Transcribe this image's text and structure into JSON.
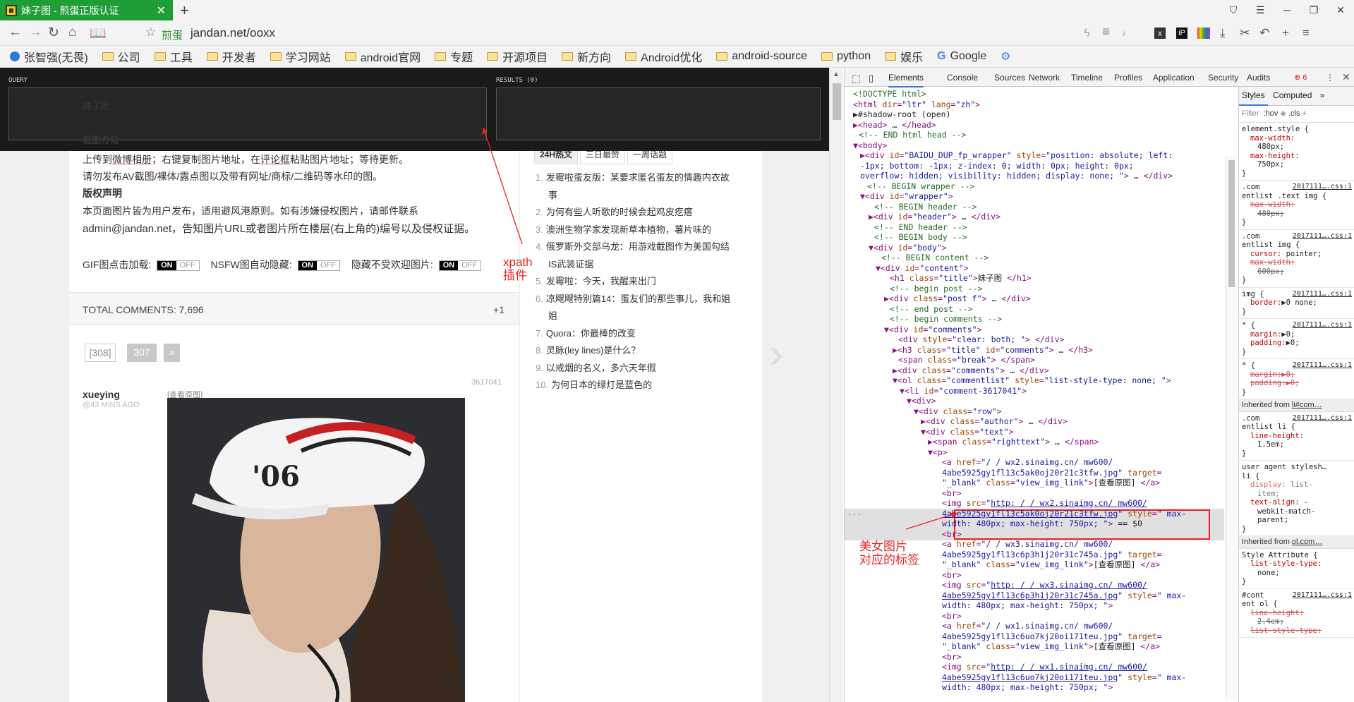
{
  "tab": {
    "title": "妹子图 - 煎蛋正版认证"
  },
  "window": {
    "new_tab": "+"
  },
  "address": {
    "label": "煎蛋",
    "url": "jandan.net/ooxx"
  },
  "bookmarks": [
    {
      "label": "张智强(无畏)",
      "type": "user"
    },
    {
      "label": "公司",
      "type": "folder"
    },
    {
      "label": "工具",
      "type": "folder"
    },
    {
      "label": "开发者",
      "type": "folder"
    },
    {
      "label": "学习网站",
      "type": "folder"
    },
    {
      "label": "android官网",
      "type": "folder"
    },
    {
      "label": "专题",
      "type": "folder"
    },
    {
      "label": "开源项目",
      "type": "folder"
    },
    {
      "label": "新方向",
      "type": "folder"
    },
    {
      "label": "Android优化",
      "type": "folder"
    },
    {
      "label": "android-source",
      "type": "folder"
    },
    {
      "label": "python",
      "type": "folder"
    },
    {
      "label": "娱乐",
      "type": "folder"
    },
    {
      "label": "Google",
      "type": "google"
    }
  ],
  "overlay": {
    "query_label": "QUERY",
    "results_label": "RESULTS (0)"
  },
  "page": {
    "ghost_title": "妹子图",
    "howto_title": "发图方法",
    "howto_line1_a": "上传到",
    "howto_line1_link": "微博相册",
    "howto_line1_b": "；右键复制图片地址，在",
    "howto_line1_link2": "评论框",
    "howto_line1_c": "粘贴图片地址；等待更新。",
    "howto_line2": "请勿发布AV截图/裸体/露点图以及带有网址/商标/二维码等水印的图。",
    "copyright_title": "版权声明",
    "copyright_line1": "本页面图片皆为用户发布，适用避风港原则。如有涉嫌侵权图片，请邮件联系",
    "copyright_line2": "admin@jandan.net，告知图片URL或者图片所在楼层(右上角的)编号以及侵权证据。",
    "gif_label": "GIF图点击加载:",
    "nsfw_label": "NSFW图自动隐藏:",
    "unpop_label": "隐藏不受欢迎图片:",
    "on": "ON",
    "off": "OFF",
    "total_comments": "TOTAL COMMENTS: 7,696",
    "plus_one": "+1",
    "pages": [
      "[308]",
      "307",
      "»"
    ],
    "comment_id": "3617041",
    "author": "xueying",
    "time": "@43 MINS AGO",
    "view_original": "[查看原图]"
  },
  "hot": {
    "tabs": [
      "24H热文",
      "三日最赞",
      "一周话题"
    ],
    "items": [
      "发霉啦蛋友版：某要求匿名蛋友的情趣内衣故",
      "事",
      "为何有些人听歌的时候会起鸡皮疙瘩",
      "澳洲生物学家发现新草本植物，薯片味的",
      "俄罗斯外交部乌龙：用游戏截图作为美国勾结",
      "IS武装证据",
      "发霉啦：今天，我醒来出门",
      "凉飕飕特别篇14：蛋友们的那些事儿，我和姐",
      "姐",
      "Quora：你最棒的改变",
      "灵脉(ley lines)是什么？",
      "以戒烟的名义，多六天年假",
      "为何日本的绿灯是蓝色的"
    ],
    "numbers": [
      "1.",
      "",
      "2.",
      "3.",
      "4.",
      "",
      "5.",
      "6.",
      "",
      "7.",
      "8.",
      "9.",
      "10."
    ]
  },
  "annotations": {
    "xpath": "xpath\n插件",
    "img_tag": "美女图片\n对应的标签"
  },
  "devtools": {
    "tabs": [
      "Elements",
      "Console",
      "Sources",
      "Network",
      "Timeline",
      "Profiles",
      "Application",
      "Security",
      "Audits"
    ],
    "error_count": "6",
    "styles_tabs": [
      "Styles",
      "Computed"
    ],
    "filter": "Filter",
    "filter_hov": ":hov",
    "filter_cls": ".cls"
  },
  "colors": {
    "tab_bg": "#1f9e37",
    "annotation": "#e22222",
    "selection": "#e0e0e0"
  }
}
